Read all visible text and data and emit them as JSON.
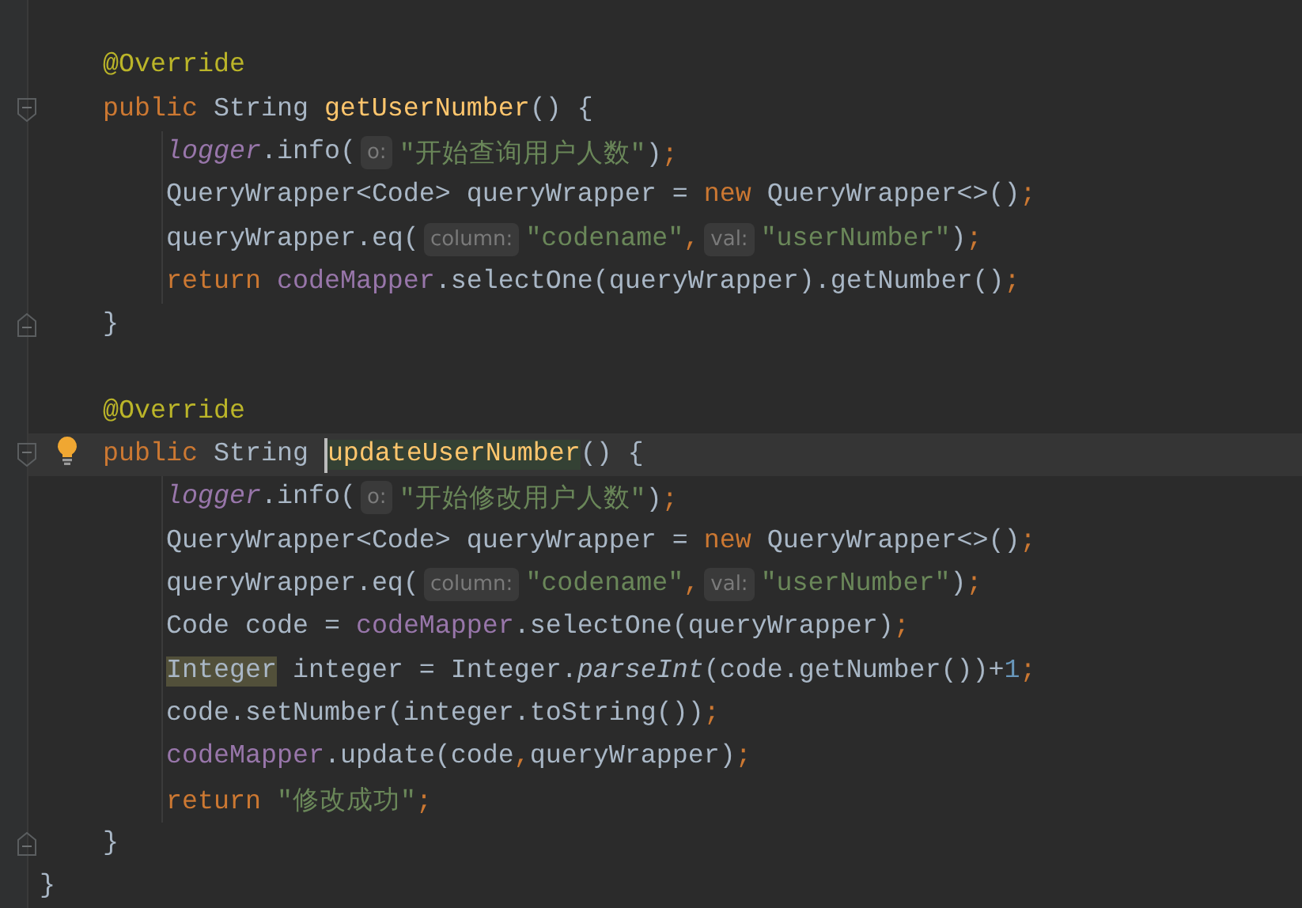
{
  "editor": {
    "class_body": [
      {
        "kind": "blank",
        "bulb": false
      },
      {
        "kind": "code",
        "bulb": false,
        "tokens": [
          {
            "text": "@Override",
            "kind": "annotation"
          }
        ]
      },
      {
        "kind": "code",
        "bulb": false,
        "tokens": [
          {
            "text": "public ",
            "kind": "keyword"
          },
          {
            "text": "String ",
            "kind": "plain"
          },
          {
            "text": "getUserNumber",
            "kind": "method"
          },
          {
            "text": "() {",
            "kind": "plain"
          }
        ],
        "children": [
          {
            "kind": "code",
            "bulb": false,
            "tokens": [
              {
                "text": "logger",
                "kind": "static-field"
              },
              {
                "text": ".info(",
                "kind": "plain"
              },
              {
                "text": "o:",
                "kind": "hint"
              },
              {
                "text": "\"开始查询用户人数\"",
                "kind": "string"
              },
              {
                "text": ")",
                "kind": "plain"
              },
              {
                "text": ";",
                "kind": "punct"
              }
            ]
          },
          {
            "kind": "code",
            "bulb": false,
            "tokens": [
              {
                "text": "QueryWrapper<Code> queryWrapper = ",
                "kind": "plain"
              },
              {
                "text": "new ",
                "kind": "keyword"
              },
              {
                "text": "QueryWrapper<>()",
                "kind": "plain"
              },
              {
                "text": ";",
                "kind": "punct"
              }
            ]
          },
          {
            "kind": "code",
            "bulb": false,
            "tokens": [
              {
                "text": "queryWrapper.eq(",
                "kind": "plain"
              },
              {
                "text": "column:",
                "kind": "hint"
              },
              {
                "text": "\"codename\"",
                "kind": "string"
              },
              {
                "text": ",",
                "kind": "punct"
              },
              {
                "text": "val:",
                "kind": "hint"
              },
              {
                "text": "\"userNumber\"",
                "kind": "string"
              },
              {
                "text": ")",
                "kind": "plain"
              },
              {
                "text": ";",
                "kind": "punct"
              }
            ]
          },
          {
            "kind": "code",
            "bulb": false,
            "tokens": [
              {
                "text": "return ",
                "kind": "keyword"
              },
              {
                "text": "codeMapper",
                "kind": "field"
              },
              {
                "text": ".selectOne(queryWrapper).getNumber()",
                "kind": "plain"
              },
              {
                "text": ";",
                "kind": "punct"
              }
            ]
          }
        ]
      },
      {
        "kind": "code",
        "bulb": false,
        "tokens": [
          {
            "text": "}",
            "kind": "plain"
          }
        ]
      },
      {
        "kind": "blank",
        "bulb": false
      },
      {
        "kind": "code",
        "bulb": false,
        "tokens": [
          {
            "text": "@Override",
            "kind": "annotation"
          }
        ]
      },
      {
        "kind": "code",
        "current": true,
        "bulb": true,
        "tokens": [
          {
            "text": "public ",
            "kind": "keyword"
          },
          {
            "text": "String ",
            "kind": "plain"
          },
          {
            "kind": "caret"
          },
          {
            "text": "updateUserNumber",
            "kind": "method",
            "highlighted": true
          },
          {
            "text": "() {",
            "kind": "plain"
          }
        ],
        "children": [
          {
            "kind": "code",
            "bulb": false,
            "tokens": [
              {
                "text": "logger",
                "kind": "static-field"
              },
              {
                "text": ".info(",
                "kind": "plain"
              },
              {
                "text": "o:",
                "kind": "hint"
              },
              {
                "text": "\"开始修改用户人数\"",
                "kind": "string"
              },
              {
                "text": ")",
                "kind": "plain"
              },
              {
                "text": ";",
                "kind": "punct"
              }
            ]
          },
          {
            "kind": "code",
            "bulb": false,
            "tokens": [
              {
                "text": "QueryWrapper<Code> queryWrapper = ",
                "kind": "plain"
              },
              {
                "text": "new ",
                "kind": "keyword"
              },
              {
                "text": "QueryWrapper<>()",
                "kind": "plain"
              },
              {
                "text": ";",
                "kind": "punct"
              }
            ]
          },
          {
            "kind": "code",
            "bulb": false,
            "tokens": [
              {
                "text": "queryWrapper.eq(",
                "kind": "plain"
              },
              {
                "text": "column:",
                "kind": "hint"
              },
              {
                "text": "\"codename\"",
                "kind": "string"
              },
              {
                "text": ",",
                "kind": "punct"
              },
              {
                "text": "val:",
                "kind": "hint"
              },
              {
                "text": "\"userNumber\"",
                "kind": "string"
              },
              {
                "text": ")",
                "kind": "plain"
              },
              {
                "text": ";",
                "kind": "punct"
              }
            ]
          },
          {
            "kind": "code",
            "bulb": false,
            "tokens": [
              {
                "text": "Code code = ",
                "kind": "plain"
              },
              {
                "text": "codeMapper",
                "kind": "field"
              },
              {
                "text": ".selectOne(queryWrapper)",
                "kind": "plain"
              },
              {
                "text": ";",
                "kind": "punct"
              }
            ]
          },
          {
            "kind": "code",
            "bulb": false,
            "tokens": [
              {
                "text": "Integer",
                "kind": "plain",
                "highlighted": true
              },
              {
                "text": " integer = Integer.",
                "kind": "plain"
              },
              {
                "text": "parseInt",
                "kind": "static-call"
              },
              {
                "text": "(code.getNumber())+",
                "kind": "plain"
              },
              {
                "text": "1",
                "kind": "number"
              },
              {
                "text": ";",
                "kind": "punct"
              }
            ]
          },
          {
            "kind": "code",
            "bulb": false,
            "tokens": [
              {
                "text": "code.setNumber(integer.toString())",
                "kind": "plain"
              },
              {
                "text": ";",
                "kind": "punct"
              }
            ]
          },
          {
            "kind": "code",
            "bulb": false,
            "tokens": [
              {
                "text": "codeMapper",
                "kind": "field"
              },
              {
                "text": ".update(code",
                "kind": "plain"
              },
              {
                "text": ",",
                "kind": "punct"
              },
              {
                "text": "queryWrapper)",
                "kind": "plain"
              },
              {
                "text": ";",
                "kind": "punct"
              }
            ]
          },
          {
            "kind": "code",
            "bulb": false,
            "tokens": [
              {
                "text": "return ",
                "kind": "keyword"
              },
              {
                "text": "\"修改成功\"",
                "kind": "string"
              },
              {
                "text": ";",
                "kind": "punct"
              }
            ]
          }
        ]
      },
      {
        "kind": "code",
        "bulb": false,
        "tokens": [
          {
            "text": "}",
            "kind": "plain"
          }
        ]
      }
    ],
    "closing": {
      "kind": "code",
      "bulb": false,
      "tokens": [
        {
          "text": "}",
          "kind": "plain"
        }
      ]
    }
  }
}
